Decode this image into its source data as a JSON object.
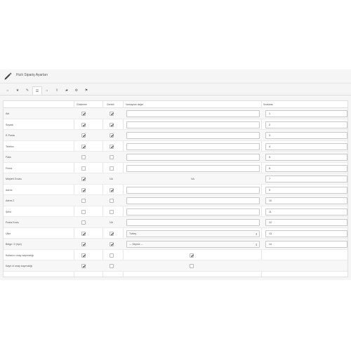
{
  "header": {
    "title": "Hızlı Sipariş Ayarları"
  },
  "toolbar": {
    "icons": [
      "home-icon",
      "star-icon",
      "pencil-icon",
      "list-icon",
      "house-icon",
      "share-icon",
      "folder-icon",
      "gear-icon",
      "tag-icon"
    ],
    "active_index": 3
  },
  "columns": {
    "field": "",
    "status": "Gösterme",
    "required": "Gerekli",
    "default": "Varsayılan değer",
    "sort": "Sıralama"
  },
  "rows": [
    {
      "label": "Adı",
      "status": true,
      "required": "check",
      "default": "input",
      "sort": "1"
    },
    {
      "label": "Soyadı",
      "status": true,
      "required": "check",
      "default": "input",
      "sort": "2"
    },
    {
      "label": "E-Posta",
      "status": true,
      "required": "check",
      "default": "input",
      "sort": "3"
    },
    {
      "label": "Telefon",
      "status": true,
      "required": "check",
      "default": "input",
      "sort": "4"
    },
    {
      "label": "Faks",
      "status": false,
      "required": "empty",
      "default": "input",
      "sort": "5"
    },
    {
      "label": "Firma",
      "status": false,
      "required": "empty",
      "default": "input",
      "sort": "6"
    },
    {
      "label": "Müşteri Grubu",
      "status": true,
      "required": "NA",
      "default": "NA",
      "sort": "7"
    },
    {
      "label": "Adres",
      "status": true,
      "required": "check",
      "default": "input",
      "sort": "9"
    },
    {
      "label": "Adres 2",
      "status": false,
      "required": "empty",
      "default": "input",
      "sort": "10"
    },
    {
      "label": "Şehir",
      "status": false,
      "required": "empty",
      "default": "input",
      "sort": "11"
    },
    {
      "label": "Posta Kodu",
      "status": false,
      "required": "NA",
      "default": "input",
      "sort": "12"
    },
    {
      "label": "Ülke",
      "status": true,
      "required": "check",
      "default": "select",
      "select_value": "Turkey",
      "sort": "13"
    },
    {
      "label": "Bölge / İl (ilçe)",
      "status": true,
      "required": "check",
      "default": "select",
      "select_value": " --- Seçiniz --- ",
      "sort": "14"
    },
    {
      "label": "Kullanıcı onay sayımalığı",
      "status": true,
      "required": "empty",
      "default": "checkbox-on",
      "sort": ""
    },
    {
      "label": "Kayıt ol onay sayımalığı",
      "status": true,
      "required": "empty",
      "default": "checkbox-off",
      "sort": ""
    }
  ]
}
